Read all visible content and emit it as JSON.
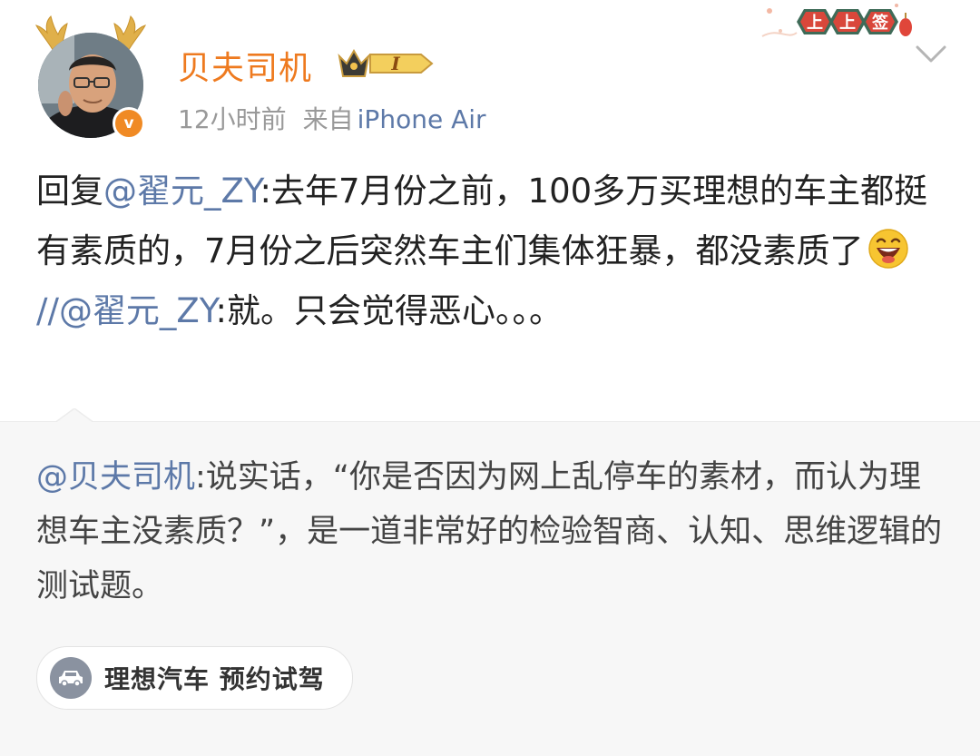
{
  "post": {
    "author": "贝夫司机",
    "vip_level": "I",
    "time": "12小时前",
    "source_prefix": "来自",
    "device": "iPhone Air",
    "festive_badge": [
      "上",
      "上",
      "签"
    ],
    "text": {
      "reply_prefix": "回复",
      "mention1": "@翟元_ZY",
      "body1": ":去年7月份之前，100多万买理想的车主都挺有素质的，7月份之后突然车主们集体狂暴，都没素质了",
      "emoji": "laugh-emoji",
      "repost_sep": "//",
      "mention2": "@翟元_ZY",
      "body2": ":就。只会觉得恶心。。。"
    }
  },
  "quote": {
    "mention": "@贝夫司机",
    "body": ":说实话，“你是否因为网上乱停车的素材，而认为理想车主没素质？”，是一道非常好的检验智商、认知、思维逻辑的测试题。"
  },
  "tag_pill": {
    "icon": "car-icon",
    "label": "理想汽车 预约试驾"
  },
  "colors": {
    "username": "#ee7a1f",
    "link": "#5d79a8",
    "verified": "#f08a24",
    "quote_bg": "#f7f7f7"
  }
}
